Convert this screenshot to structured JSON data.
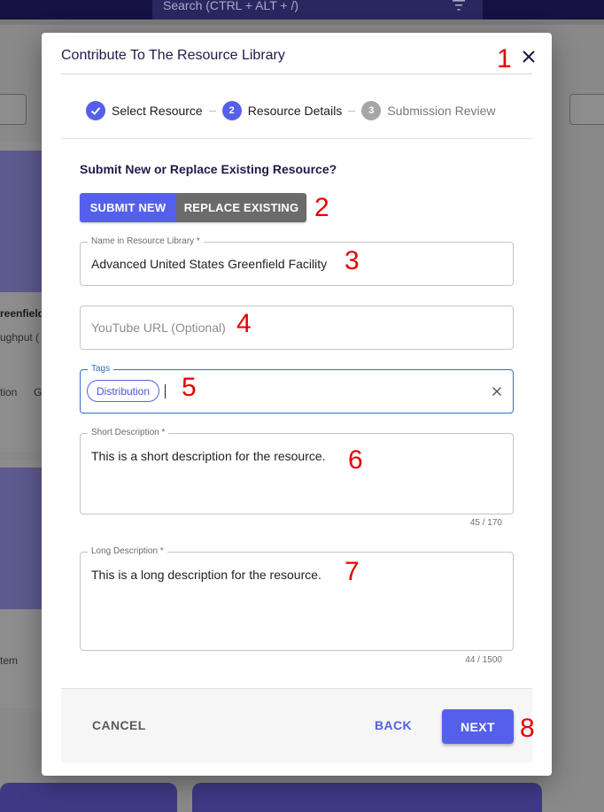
{
  "background": {
    "search_text": "Search (CTRL + ALT + /)",
    "card_title_fragment": "reenfield",
    "card_sub_fragment": "ughput (",
    "card_tag_fragment_1": "tion",
    "card_tag_fragment_2": "G",
    "card_item_fragment": "tem"
  },
  "dialog": {
    "title": "Contribute To The Resource Library",
    "close_icon": "close-icon"
  },
  "stepper": {
    "steps": [
      {
        "label": "Select Resource",
        "status": "completed",
        "icon": "check-icon"
      },
      {
        "label": "Resource Details",
        "number": "2",
        "status": "active"
      },
      {
        "label": "Submission Review",
        "number": "3",
        "status": "inactive"
      }
    ]
  },
  "form": {
    "question": "Submit New or Replace Existing Resource?",
    "submit_new_label": "SUBMIT NEW",
    "replace_existing_label": "REPLACE EXISTING",
    "name": {
      "label": "Name in Resource Library *",
      "value": "Advanced United States Greenfield Facility"
    },
    "youtube": {
      "placeholder": "YouTube URL (Optional)"
    },
    "tags": {
      "label": "Tags",
      "chips": [
        "Distribution"
      ]
    },
    "short_description": {
      "label": "Short Description *",
      "value": "This is a short description for the resource.",
      "counter": "45 / 170"
    },
    "long_description": {
      "label": "Long Description *",
      "value": "This is a long description for the resource.",
      "counter": "44 / 1500"
    }
  },
  "footer": {
    "cancel_label": "CANCEL",
    "back_label": "BACK",
    "next_label": "NEXT"
  },
  "annotations": [
    "1",
    "2",
    "3",
    "4",
    "5",
    "6",
    "7",
    "8"
  ],
  "colors": {
    "accent": "#5560ea",
    "navy_text": "#1e1b4b",
    "annotation_red": "#e60000",
    "focus_border": "#2e6dc9"
  }
}
